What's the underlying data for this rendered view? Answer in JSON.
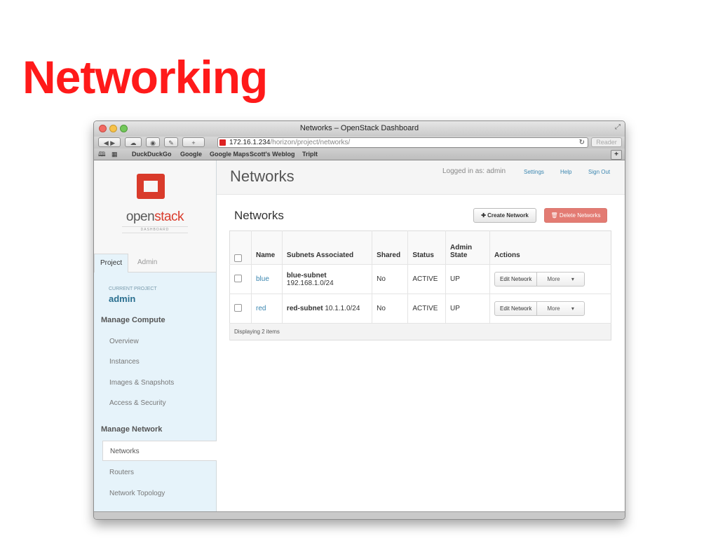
{
  "slide": {
    "title": "Networking"
  },
  "browser": {
    "window_title": "Networks – OpenStack Dashboard",
    "url_host": "172.16.1.234",
    "url_path": "/horizon/project/networks/",
    "reader_label": "Reader",
    "bookmarks": [
      "DuckDuckGo",
      "Google",
      "Google Maps",
      "Scott's Weblog",
      "Triplt"
    ]
  },
  "sidebar": {
    "logo_prefix": "open",
    "logo_suffix": "stack",
    "logo_sub": "DASHBOARD",
    "tabs": [
      "Project",
      "Admin"
    ],
    "current_project_label": "CURRENT PROJECT",
    "current_project": "admin",
    "compute_heading": "Manage Compute",
    "compute_items": [
      "Overview",
      "Instances",
      "Images & Snapshots",
      "Access & Security"
    ],
    "network_heading": "Manage Network",
    "network_items": [
      "Networks",
      "Routers",
      "Network Topology"
    ]
  },
  "header": {
    "page_title": "Networks",
    "logged_in": "Logged in as: admin",
    "settings": "Settings",
    "help": "Help",
    "sign_out": "Sign Out"
  },
  "table": {
    "title": "Networks",
    "create_label": "Create Network",
    "delete_label": "Delete Networks",
    "columns": [
      "Name",
      "Subnets Associated",
      "Shared",
      "Status",
      "Admin State",
      "Actions"
    ],
    "rows": [
      {
        "name": "blue",
        "subnet_name": "blue-subnet",
        "subnet_cidr": "192.168.1.0/24",
        "shared": "No",
        "status": "ACTIVE",
        "admin_state": "UP",
        "action": "Edit Network",
        "more": "More"
      },
      {
        "name": "red",
        "subnet_name": "red-subnet",
        "subnet_cidr": "10.1.1.0/24",
        "shared": "No",
        "status": "ACTIVE",
        "admin_state": "UP",
        "action": "Edit Network",
        "more": "More"
      }
    ],
    "footer": "Displaying 2 items"
  }
}
